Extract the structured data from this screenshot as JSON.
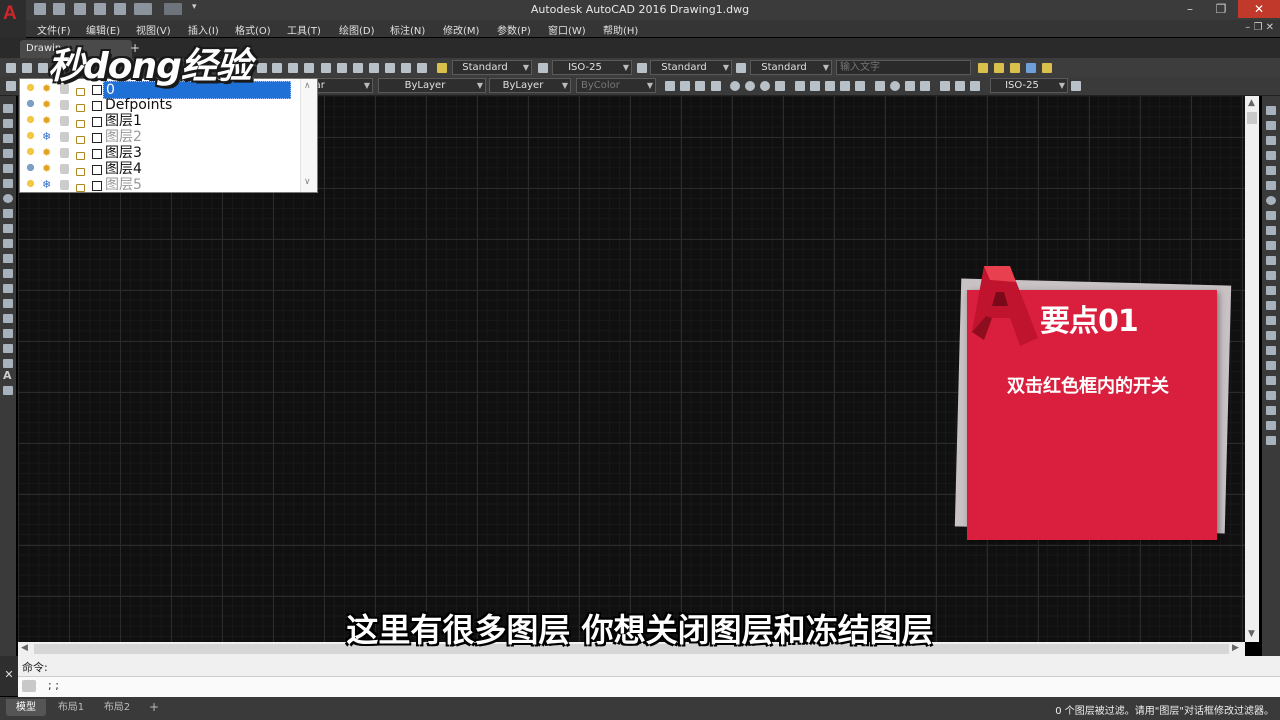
{
  "window": {
    "title": "Autodesk AutoCAD 2016    Drawing1.dwg",
    "app_logo": "A"
  },
  "menubar": {
    "items": [
      "文件(F)",
      "编辑(E)",
      "视图(V)",
      "插入(I)",
      "格式(O)",
      "工具(T)",
      "绘图(D)",
      "标注(N)",
      "修改(M)",
      "参数(P)",
      "窗口(W)",
      "帮助(H)"
    ]
  },
  "tabs": {
    "document": "Drawin",
    "new_tab": "+"
  },
  "toolbar1": {
    "text_style": "Standard",
    "dim_style": "ISO-25",
    "table_style": "Standard",
    "mleader_style": "Standard",
    "search_placeholder": "输入文字"
  },
  "toolbar2": {
    "layer_color_partial": "Lar",
    "linetype": "ByLayer",
    "lineweight": "ByLayer",
    "plot_style": "ByColor",
    "dim_style2": "ISO-25"
  },
  "layer_dropdown": {
    "layers": [
      {
        "name": "0",
        "on": true,
        "frozen": false,
        "selected": true
      },
      {
        "name": "Defpoints",
        "on": false,
        "frozen": false,
        "selected": false
      },
      {
        "name": "图层1",
        "on": true,
        "frozen": false,
        "selected": false
      },
      {
        "name": "图层2",
        "on": true,
        "frozen": true,
        "selected": false
      },
      {
        "name": "图层3",
        "on": true,
        "frozen": false,
        "selected": false
      },
      {
        "name": "图层4",
        "on": false,
        "frozen": false,
        "selected": false
      },
      {
        "name": "图层5",
        "on": true,
        "frozen": true,
        "selected": false
      }
    ]
  },
  "watermark": {
    "text": "秒dong经验"
  },
  "tip_card": {
    "title": "要点01",
    "body": "双击红色框内的开关",
    "colors": {
      "card": "#d91f3d",
      "shadow": "#c8c2c4"
    }
  },
  "subtitle": "这里有很多图层 你想关闭图层和冻结图层",
  "command": {
    "history": "命令:",
    "input": "; ;"
  },
  "statusbar": {
    "layout_tabs": [
      "模型",
      "布局1",
      "布局2"
    ],
    "active_tab": "模型",
    "add": "+",
    "message": "0 个图层被过滤。请用\"图层\"对话框修改过滤器。"
  }
}
